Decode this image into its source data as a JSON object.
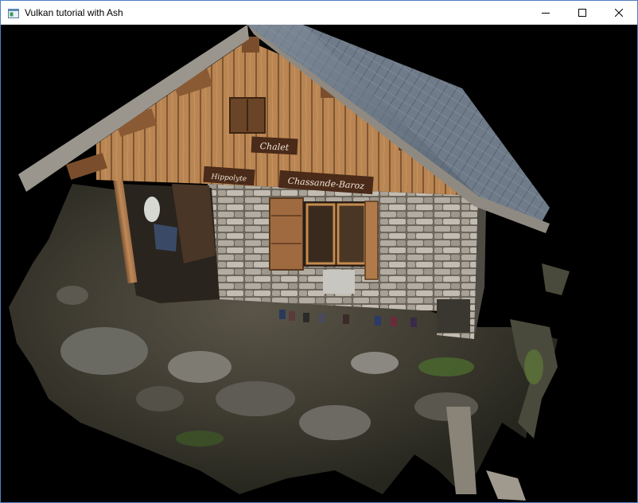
{
  "window": {
    "title": "Vulkan tutorial with Ash",
    "app_icon": "window-app-icon",
    "controls": [
      "minimize-icon",
      "maximize-icon",
      "close-icon"
    ]
  },
  "scene": {
    "signs": {
      "upper": "Chalet",
      "left": "Hippolyte",
      "right": "Chassande-Baroz"
    }
  },
  "colors": {
    "titlebar": "#ffffff",
    "border": "#4f7fbf",
    "viewport_bg": "#000000"
  }
}
